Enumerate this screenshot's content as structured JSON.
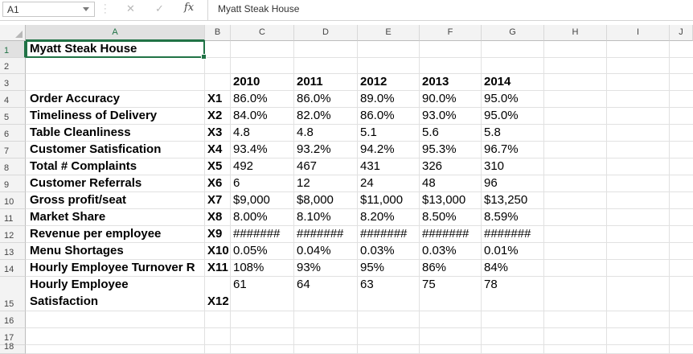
{
  "formula_bar": {
    "name_box": "A1",
    "cancel_icon": "✕",
    "enter_icon": "✓",
    "fx_label": "fx",
    "formula": "Myatt Steak House"
  },
  "columns": [
    "A",
    "B",
    "C",
    "D",
    "E",
    "F",
    "G",
    "H",
    "I",
    "J"
  ],
  "rows": [
    "1",
    "2",
    "3",
    "4",
    "5",
    "6",
    "7",
    "8",
    "9",
    "10",
    "11",
    "12",
    "13",
    "14",
    "15",
    "16",
    "17",
    "18"
  ],
  "sheet": {
    "title": "Myatt Steak House",
    "years": [
      "2010",
      "2011",
      "2012",
      "2013",
      "2014"
    ],
    "metrics": [
      {
        "label": "Order Accuracy",
        "code": "X1",
        "values": [
          "86.0%",
          "86.0%",
          "89.0%",
          "90.0%",
          "95.0%"
        ]
      },
      {
        "label": "Timeliness of Delivery",
        "code": "X2",
        "values": [
          "84.0%",
          "82.0%",
          "86.0%",
          "93.0%",
          "95.0%"
        ]
      },
      {
        "label": "Table Cleanliness",
        "code": "X3",
        "values": [
          "4.8",
          "4.8",
          "5.1",
          "5.6",
          "5.8"
        ]
      },
      {
        "label": "Customer Satisfication",
        "code": "X4",
        "values": [
          "93.4%",
          "93.2%",
          "94.2%",
          "95.3%",
          "96.7%"
        ]
      },
      {
        "label": "Total # Complaints",
        "code": "X5",
        "values": [
          "492",
          "467",
          "431",
          "326",
          "310"
        ]
      },
      {
        "label": "Customer Referrals",
        "code": "X6",
        "values": [
          "6",
          "12",
          "24",
          "48",
          "96"
        ]
      },
      {
        "label": "Gross profit/seat",
        "code": "X7",
        "values": [
          "$9,000",
          "$8,000",
          "$11,000",
          "$13,000",
          "$13,250"
        ]
      },
      {
        "label": "Market Share",
        "code": "X8",
        "values": [
          "8.00%",
          "8.10%",
          "8.20%",
          "8.50%",
          "8.59%"
        ]
      },
      {
        "label": "Revenue per employee",
        "code": "X9",
        "values": [
          "#######",
          "#######",
          "#######",
          "#######",
          "#######"
        ]
      },
      {
        "label": "Menu Shortages",
        "code": "X10",
        "values": [
          "0.05%",
          "0.04%",
          "0.03%",
          "0.03%",
          "0.01%"
        ]
      },
      {
        "label": "Hourly Employee Turnover R",
        "code": "X11",
        "values": [
          "108%",
          "93%",
          "95%",
          "86%",
          "84%"
        ]
      }
    ],
    "row15": {
      "label_line1": "Hourly Employee",
      "label_line2": "Satisfaction",
      "code": "X12",
      "values": [
        "61",
        "64",
        "63",
        "75",
        "78"
      ]
    }
  }
}
